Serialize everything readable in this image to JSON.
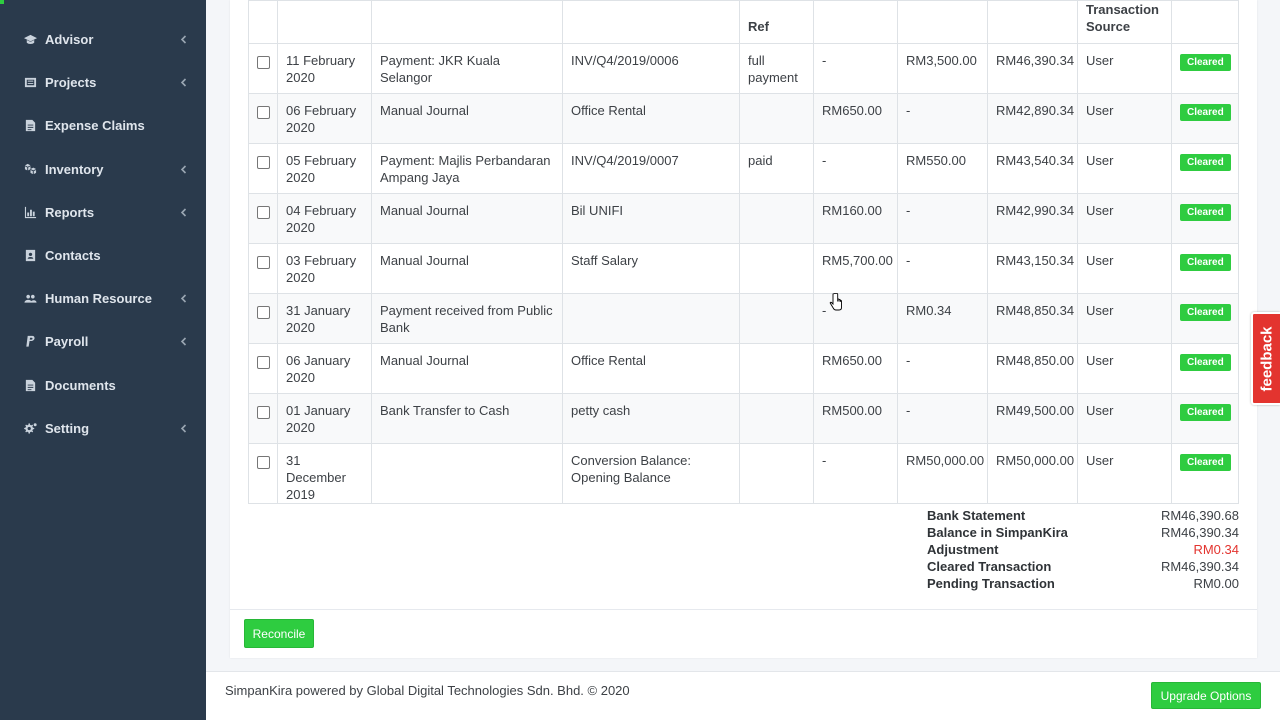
{
  "colors": {
    "sidebar_bg": "#2a3a4c",
    "accent_green": "#2ecc40",
    "negative_red": "#e3342f",
    "feedback_red": "#e3342f"
  },
  "sidebar": {
    "items": [
      {
        "label": "Advisor",
        "icon": "graduation-cap-icon",
        "has_submenu": true
      },
      {
        "label": "Projects",
        "icon": "projects-icon",
        "has_submenu": true
      },
      {
        "label": "Expense Claims",
        "icon": "file-icon",
        "has_submenu": false
      },
      {
        "label": "Inventory",
        "icon": "cubes-icon",
        "has_submenu": true
      },
      {
        "label": "Reports",
        "icon": "bar-chart-icon",
        "has_submenu": true
      },
      {
        "label": "Contacts",
        "icon": "address-book-icon",
        "has_submenu": false
      },
      {
        "label": "Human Resource",
        "icon": "users-icon",
        "has_submenu": true
      },
      {
        "label": "Payroll",
        "icon": "paypal-icon",
        "has_submenu": true
      },
      {
        "label": "Documents",
        "icon": "file-icon",
        "has_submenu": false
      },
      {
        "label": "Setting",
        "icon": "cogs-icon",
        "has_submenu": true
      }
    ]
  },
  "table": {
    "headers": [
      "",
      "",
      "",
      "",
      "Ref",
      "",
      "",
      "",
      "Transaction Source",
      ""
    ],
    "rows": [
      {
        "date": "11 February 2020",
        "description": "Payment: JKR Kuala Selangor",
        "reference": "INV/Q4/2019/0006",
        "ref": "full payment",
        "spent": "-",
        "received": "RM3,500.00",
        "balance": "RM46,390.34",
        "source": "User",
        "status": "Cleared"
      },
      {
        "date": "06 February 2020",
        "description": "Manual Journal",
        "reference": "Office Rental",
        "ref": "",
        "spent": "RM650.00",
        "received": "-",
        "balance": "RM42,890.34",
        "source": "User",
        "status": "Cleared"
      },
      {
        "date": "05 February 2020",
        "description": "Payment: Majlis Perbandaran Ampang Jaya",
        "reference": "INV/Q4/2019/0007",
        "ref": "paid",
        "spent": "-",
        "received": "RM550.00",
        "balance": "RM43,540.34",
        "source": "User",
        "status": "Cleared"
      },
      {
        "date": "04 February 2020",
        "description": "Manual Journal",
        "reference": "Bil UNIFI",
        "ref": "",
        "spent": "RM160.00",
        "received": "-",
        "balance": "RM42,990.34",
        "source": "User",
        "status": "Cleared"
      },
      {
        "date": "03 February 2020",
        "description": "Manual Journal",
        "reference": "Staff Salary",
        "ref": "",
        "spent": "RM5,700.00",
        "received": "-",
        "balance": "RM43,150.34",
        "source": "User",
        "status": "Cleared"
      },
      {
        "date": "31 January 2020",
        "description": "Payment received from Public Bank",
        "reference": "",
        "ref": "",
        "spent": "-",
        "received": "RM0.34",
        "balance": "RM48,850.34",
        "source": "User",
        "status": "Cleared"
      },
      {
        "date": "06 January 2020",
        "description": "Manual Journal",
        "reference": "Office Rental",
        "ref": "",
        "spent": "RM650.00",
        "received": "-",
        "balance": "RM48,850.00",
        "source": "User",
        "status": "Cleared"
      },
      {
        "date": "01 January 2020",
        "description": "Bank Transfer to Cash",
        "reference": "petty cash",
        "ref": "",
        "spent": "RM500.00",
        "received": "-",
        "balance": "RM49,500.00",
        "source": "User",
        "status": "Cleared"
      },
      {
        "date": "31 December 2019",
        "description": "",
        "reference": "Conversion Balance: Opening Balance",
        "ref": "",
        "spent": "-",
        "received": "RM50,000.00",
        "balance": "RM50,000.00",
        "source": "User",
        "status": "Cleared"
      }
    ]
  },
  "summary": [
    {
      "label": "Bank Statement",
      "value": "RM46,390.68",
      "negative": false
    },
    {
      "label": "Balance in SimpanKira",
      "value": "RM46,390.34",
      "negative": false
    },
    {
      "label": "Adjustment",
      "value": "RM0.34",
      "negative": true
    },
    {
      "label": "Cleared Transaction",
      "value": "RM46,390.34",
      "negative": false
    },
    {
      "label": "Pending Transaction",
      "value": "RM0.00",
      "negative": false
    }
  ],
  "actions": {
    "reconcile_label": "Reconcile",
    "upgrade_label": "Upgrade Options"
  },
  "footer": {
    "text": "SimpanKira powered by Global Digital Technologies Sdn. Bhd. © 2020"
  },
  "feedback": {
    "label": "feedback"
  }
}
